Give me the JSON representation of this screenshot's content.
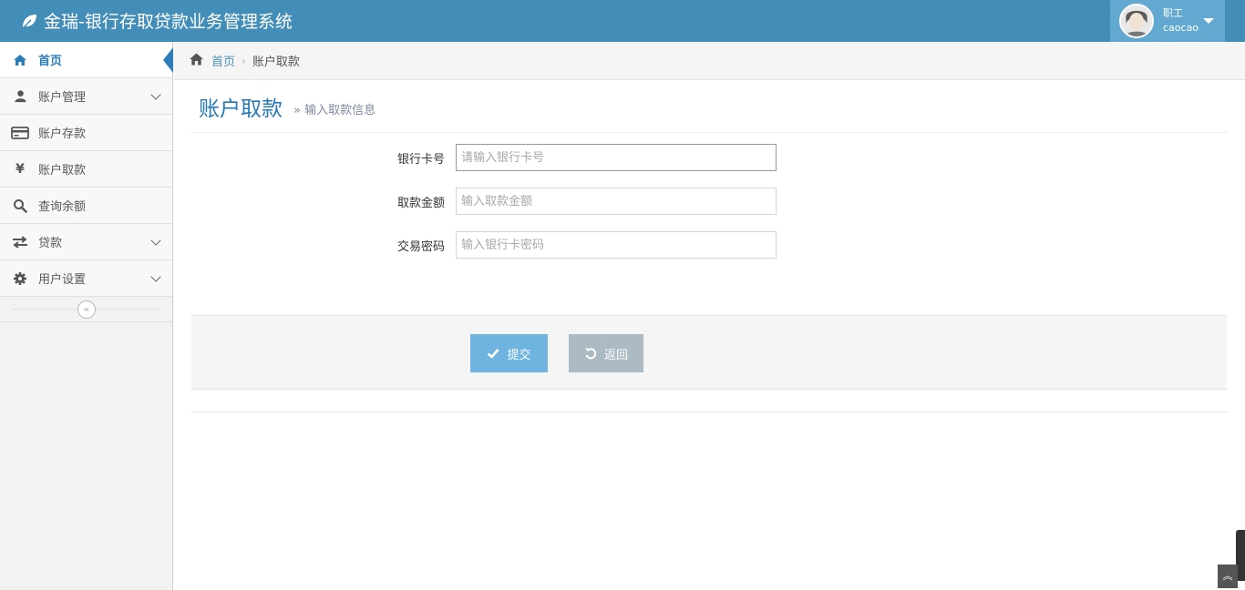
{
  "app": {
    "title": "金瑞-银行存取贷款业务管理系统"
  },
  "user": {
    "role": "职工",
    "username": "caocao"
  },
  "sidebar": {
    "items": [
      {
        "label": "首页",
        "icon": "home-icon",
        "active": true
      },
      {
        "label": "账户管理",
        "icon": "user-icon",
        "has_submenu": true
      },
      {
        "label": "账户存款",
        "icon": "credit-card-icon"
      },
      {
        "label": "账户取款",
        "icon": "yen-icon"
      },
      {
        "label": "查询余额",
        "icon": "search-icon"
      },
      {
        "label": "贷款",
        "icon": "exchange-icon",
        "has_submenu": true
      },
      {
        "label": "用户设置",
        "icon": "gear-icon",
        "has_submenu": true
      }
    ],
    "collapse_glyph": "«"
  },
  "breadcrumb": {
    "home": "首页",
    "current": "账户取款"
  },
  "page": {
    "title": "账户取款",
    "subtitle_prefix": "»",
    "subtitle": "输入取款信息"
  },
  "form": {
    "card_number": {
      "label": "银行卡号",
      "placeholder": "请输入银行卡号",
      "value": ""
    },
    "amount": {
      "label": "取款金额",
      "placeholder": "输入取款金额",
      "value": ""
    },
    "password": {
      "label": "交易密码",
      "placeholder": "输入银行卡密码",
      "value": ""
    }
  },
  "actions": {
    "submit_label": "提交",
    "back_label": "返回"
  },
  "colors": {
    "navbar": "#438eb9",
    "accent": "#2679b5",
    "submit": "#6fb3e0",
    "back": "#abbac3"
  }
}
